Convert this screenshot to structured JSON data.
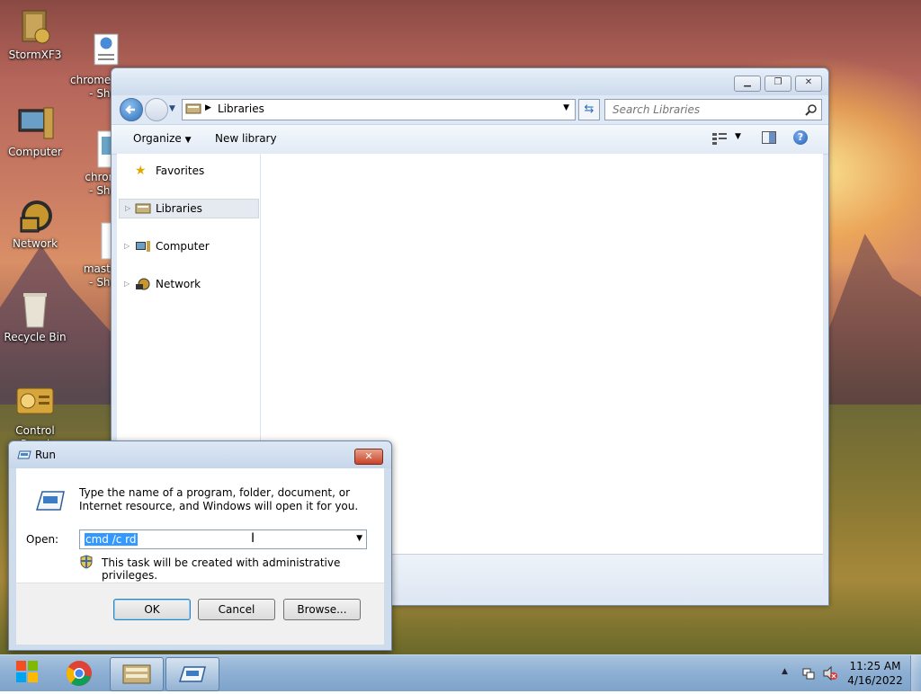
{
  "desktop": {
    "icons": [
      {
        "label": "StormXF3",
        "icon": "app-icon"
      },
      {
        "label": "Computer",
        "icon": "computer-icon"
      },
      {
        "label": "Network",
        "icon": "network-icon"
      },
      {
        "label": "Recycle Bin",
        "icon": "recycle-bin-icon"
      },
      {
        "label": "Control Panel",
        "icon": "control-panel-icon"
      },
      {
        "label": "chrome.Vis...\n- Shor",
        "icon": "shortcut-icon"
      },
      {
        "label": "chrome\n- Shor",
        "icon": "shortcut-icon"
      },
      {
        "label": "master_\n- Shor",
        "icon": "shortcut-icon"
      }
    ]
  },
  "explorer": {
    "address_path": "Libraries",
    "search_placeholder": "Search Libraries",
    "toolbar": {
      "organize": "Organize",
      "new_library": "New library"
    },
    "nav_items": [
      {
        "label": "Favorites",
        "icon": "star-icon"
      },
      {
        "label": "Libraries",
        "icon": "libraries-icon",
        "selected": true
      },
      {
        "label": "Computer",
        "icon": "computer-icon"
      },
      {
        "label": "Network",
        "icon": "network-icon"
      }
    ]
  },
  "run_dialog": {
    "title": "Run",
    "description": "Type the name of a program, folder, document, or Internet resource, and Windows will open it for you.",
    "open_label": "Open:",
    "open_value": "cmd /c rd",
    "admin_notice": "This task will be created with administrative privileges.",
    "buttons": {
      "ok": "OK",
      "cancel": "Cancel",
      "browse": "Browse..."
    }
  },
  "taskbar": {
    "time": "11:25 AM",
    "date": "4/16/2022"
  },
  "colors": {
    "accent": "#3399ff",
    "selection": "#3399ff",
    "taskbar": "#8eb0d4"
  }
}
